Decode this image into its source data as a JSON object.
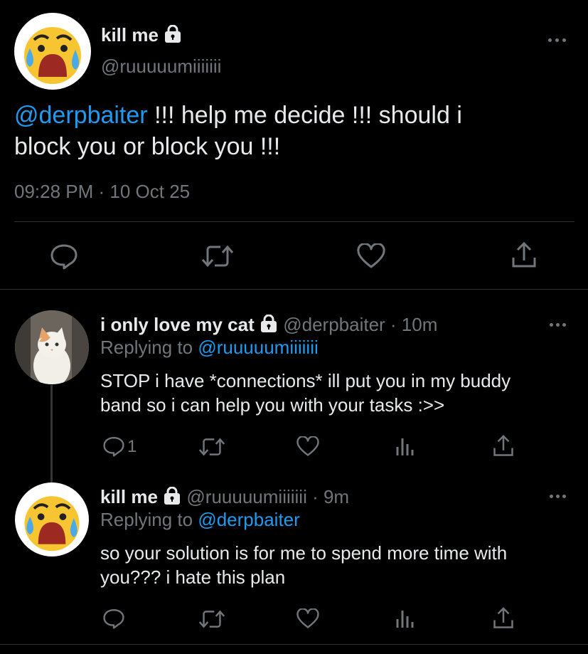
{
  "main_tweet": {
    "display_name": "kill me",
    "handle": "@ruuuuumiiiiiii",
    "mention": "@derpbaiter",
    "text_line1": " !!! help me decide !!! should i",
    "text_line2": "block you or block you !!!",
    "timestamp": "09:28 PM · 10 Oct 25"
  },
  "replies": [
    {
      "display_name": "i only love my cat",
      "handle": "@derpbaiter",
      "time": " · 10m",
      "replying_prefix": "Replying to ",
      "replying_to": "@ruuuuumiiiiiii",
      "text_line1": "STOP i have *connections* ill put you in my buddy",
      "text_line2": "band so i can help you with your tasks :>>",
      "reply_count": "1"
    },
    {
      "display_name": "kill me",
      "handle": "@ruuuuumiiiiiii",
      "time": " · 9m",
      "replying_prefix": "Replying to ",
      "replying_to": "@derpbaiter",
      "text_line1": "so your solution is for me to spend more time with",
      "text_line2": "you??? i hate this plan",
      "reply_count": ""
    }
  ],
  "colors": {
    "background": "#000000",
    "text": "#e7e9ea",
    "muted": "#71767b",
    "link": "#1d9bf0",
    "divider": "#2f3336"
  },
  "icons": [
    "reply-icon",
    "retweet-icon",
    "like-icon",
    "share-icon",
    "analytics-icon",
    "lock-icon",
    "more-icon"
  ]
}
